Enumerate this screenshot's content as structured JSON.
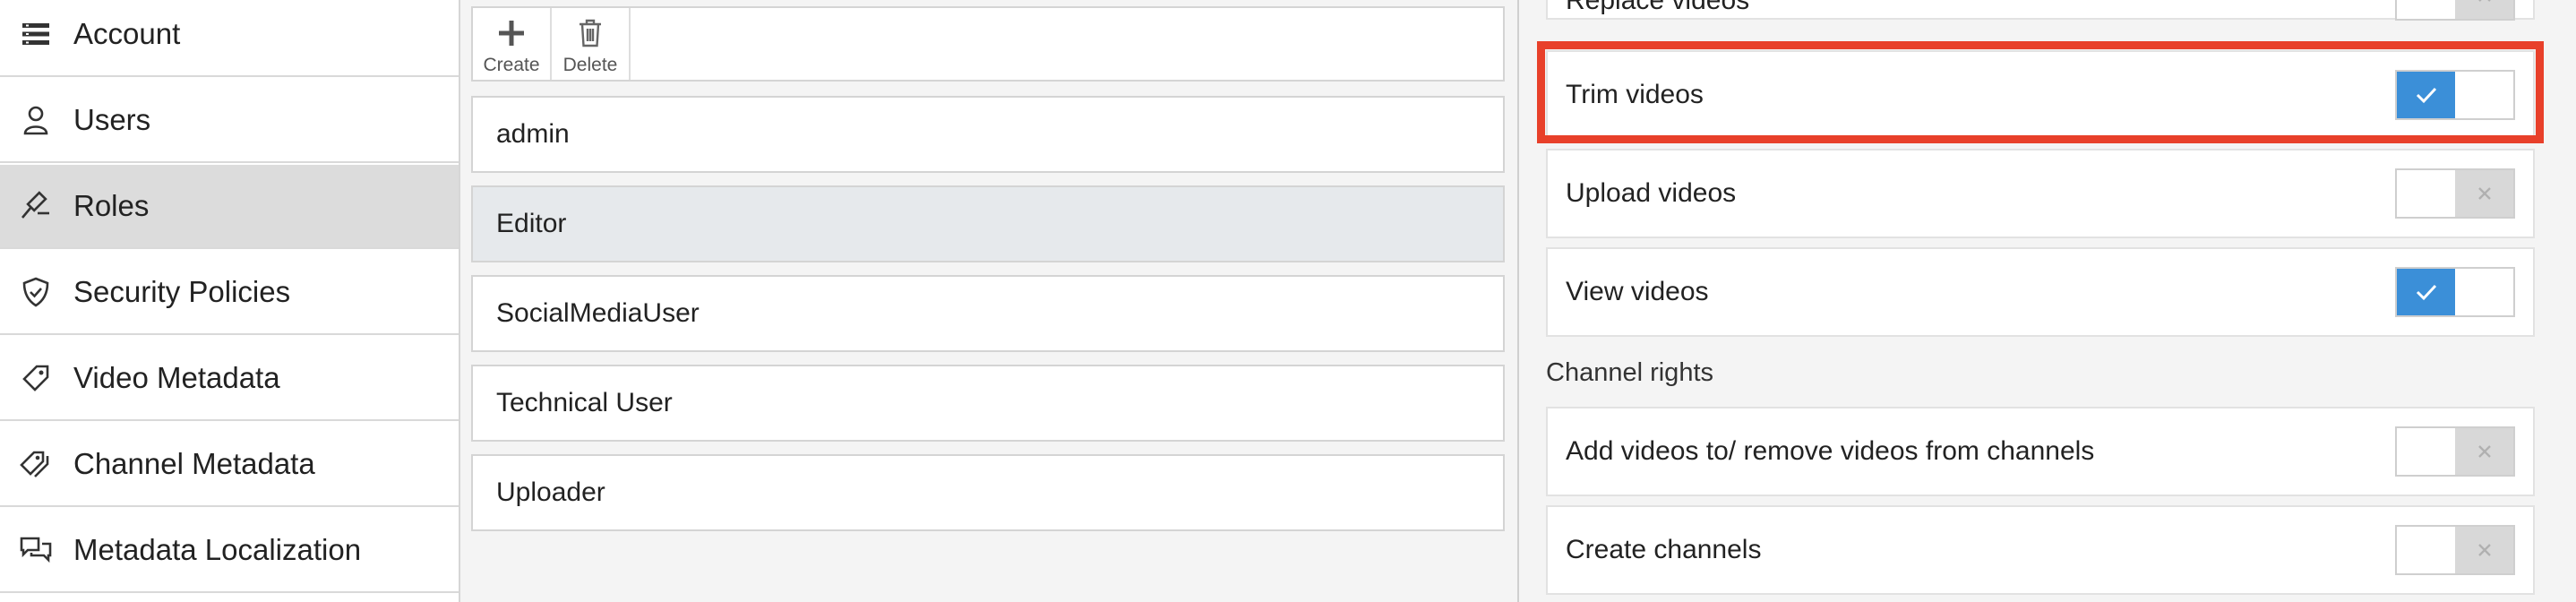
{
  "sidebar": {
    "items": [
      {
        "label": "Account",
        "icon": "list-icon"
      },
      {
        "label": "Users",
        "icon": "user-icon"
      },
      {
        "label": "Roles",
        "icon": "gavel-icon",
        "active": true
      },
      {
        "label": "Security Policies",
        "icon": "shield-icon"
      },
      {
        "label": "Video Metadata",
        "icon": "tag-icon"
      },
      {
        "label": "Channel Metadata",
        "icon": "tags-icon"
      },
      {
        "label": "Metadata Localization",
        "icon": "chat-bubbles-icon"
      }
    ]
  },
  "toolbar": {
    "create_label": "Create",
    "delete_label": "Delete"
  },
  "roles": {
    "items": [
      "admin",
      "Editor",
      "SocialMediaUser",
      "Technical User",
      "Uploader"
    ],
    "selected": "Editor"
  },
  "permissions": {
    "partial_top": {
      "label": "Replace videos",
      "enabled": false
    },
    "video_rights": [
      {
        "label": "Trim videos",
        "enabled": true
      },
      {
        "label": "Upload videos",
        "enabled": false
      },
      {
        "label": "View videos",
        "enabled": true
      }
    ],
    "channel_section_title": "Channel rights",
    "channel_rights": [
      {
        "label": "Add videos to/ remove videos from channels",
        "enabled": false
      },
      {
        "label": "Create channels",
        "enabled": false
      }
    ]
  },
  "colors": {
    "toggle_on": "#3b8fd8",
    "highlight": "#e8402a",
    "active_nav": "#dcdcdc"
  }
}
